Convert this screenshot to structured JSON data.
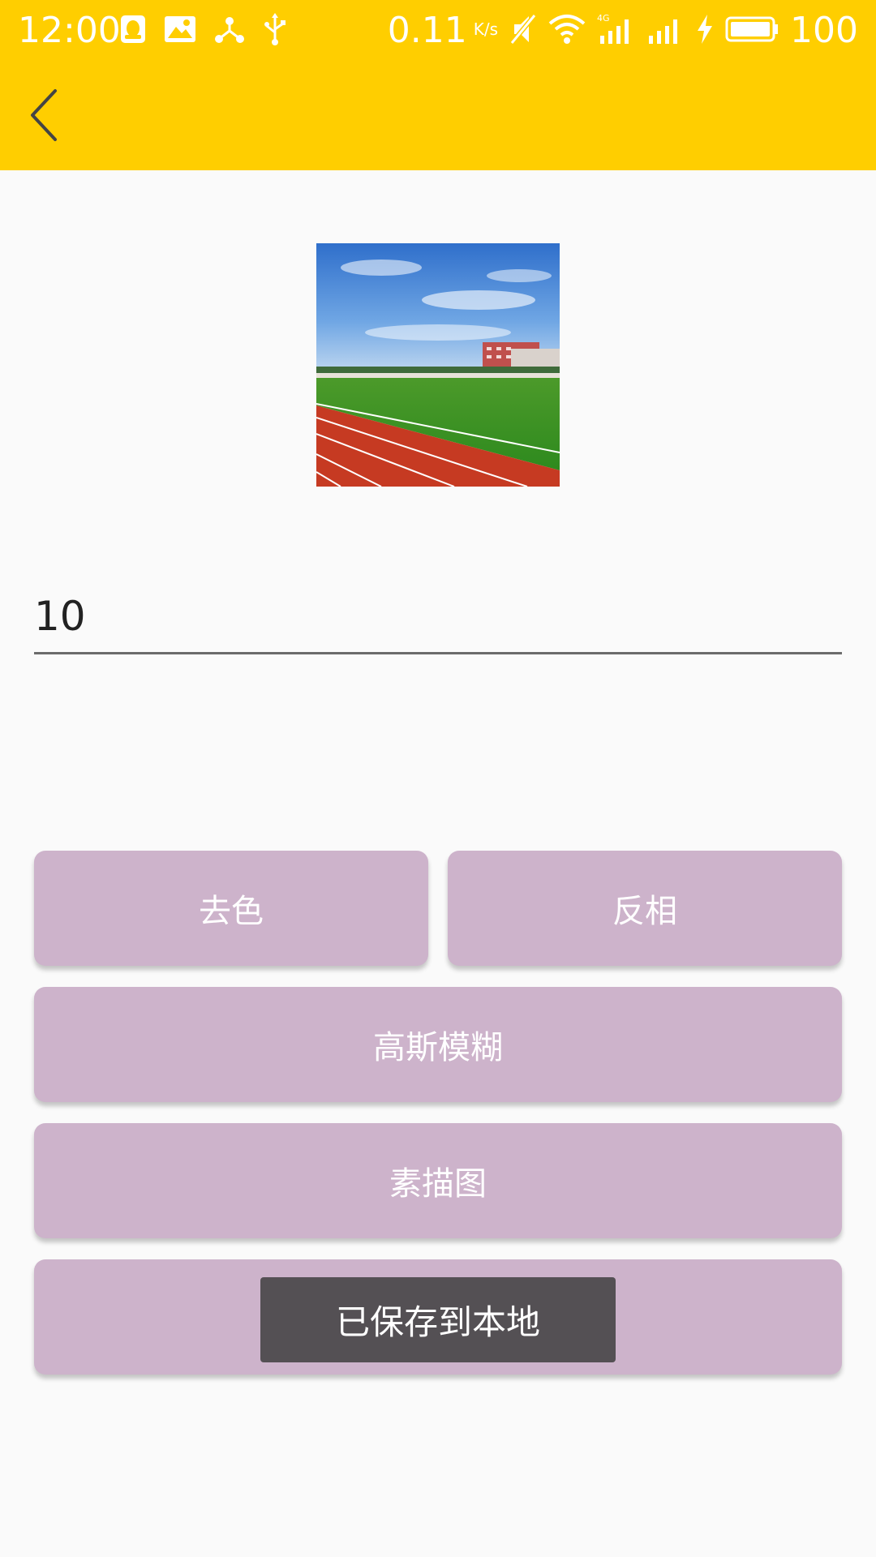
{
  "status_bar": {
    "time": "12:00",
    "net_speed": "0.11",
    "net_speed_unit": "K/s",
    "battery": "100",
    "icons": [
      "qq-icon",
      "gallery-icon",
      "share-hub-icon",
      "usb-icon",
      "mute-icon",
      "wifi-icon",
      "signal-4g-icon",
      "signal-icon",
      "charging-icon",
      "battery-icon"
    ]
  },
  "toolbar": {
    "back_icon": "chevron-left-icon",
    "background": "#FFCE00"
  },
  "preview_image": {
    "description_icon": "sports-field-photo"
  },
  "value_field": {
    "value": "10"
  },
  "buttons": {
    "desaturate": "去色",
    "invert": "反相",
    "gaussian_blur": "高斯模糊",
    "sketch": "素描图",
    "color": "#CDB3CB"
  },
  "toast": {
    "message": "已保存到本地"
  }
}
